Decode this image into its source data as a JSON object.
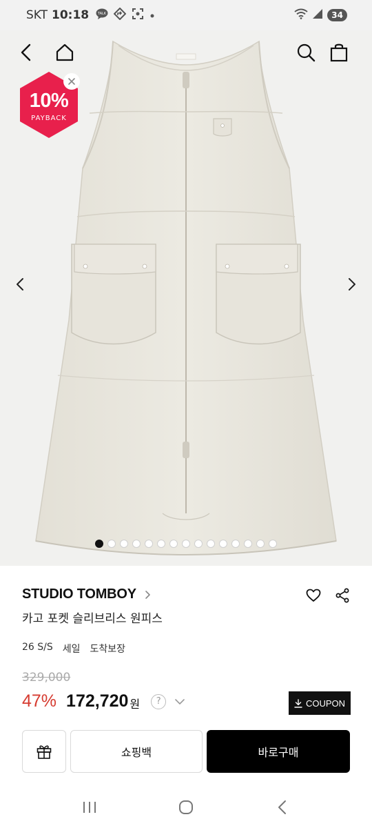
{
  "status_bar": {
    "carrier": "SKT",
    "time": "10:18",
    "battery": "34",
    "icons": [
      "talk-icon",
      "navigation-icon",
      "screenshot-icon",
      "dot-icon",
      "wifi-icon",
      "signal-icon"
    ]
  },
  "hero": {
    "badge_value": "10%",
    "badge_label": "PAYBACK",
    "badge_color": "#e8204c",
    "dots_total": 15,
    "active_dot": 1
  },
  "product": {
    "brand": "STUDIO TOMBOY",
    "name": "카고 포켓 슬리브리스 원피스",
    "tags": [
      "26 S/S",
      "세일",
      "도착보장"
    ],
    "original_price": "329,000",
    "discount": "47%",
    "price": "172,720",
    "currency": "원",
    "help_label": "?",
    "discount_color": "#d63b30"
  },
  "buttons": {
    "coupon": "COUPON",
    "cart": "쇼핑백",
    "buy": "바로구매"
  }
}
